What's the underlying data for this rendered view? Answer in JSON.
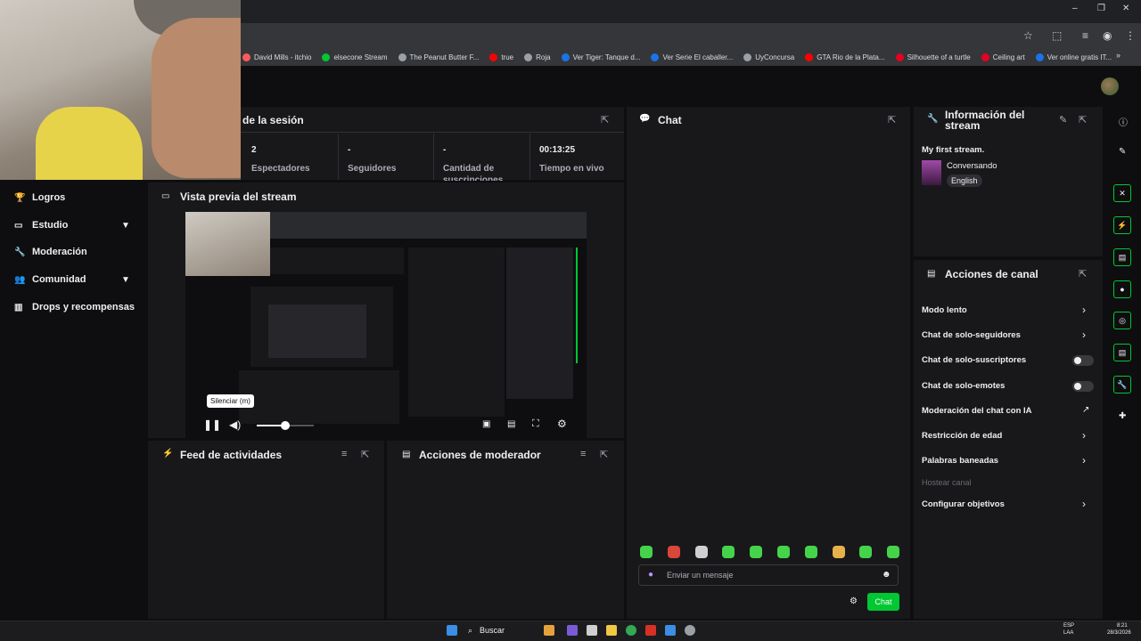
{
  "browser": {
    "bookmarks": [
      {
        "label": "David Mills - itchio",
        "color": "#fa5c5c"
      },
      {
        "label": "elsecone Stream",
        "color": "#00c832"
      },
      {
        "label": "The Peanut Butter F...",
        "color": "#9aa0a6"
      },
      {
        "label": "true",
        "color": "#ff0000"
      },
      {
        "label": "Roja",
        "color": "#9aa0a6"
      },
      {
        "label": "Ver Tiger: Tanque d...",
        "color": "#1a73e8"
      },
      {
        "label": "Ver Serie El caballer...",
        "color": "#1a73e8"
      },
      {
        "label": "UyConcursa",
        "color": "#9aa0a6"
      },
      {
        "label": "GTA Rio de la Plata...",
        "color": "#ff0000"
      },
      {
        "label": "Silhouette of a turtle",
        "color": "#e60023"
      },
      {
        "label": "Ceiling art",
        "color": "#e60023"
      },
      {
        "label": "Ver online gratis IT...",
        "color": "#1a73e8"
      }
    ],
    "window_controls": {
      "minimize": "–",
      "restore": "❐",
      "close": "✕"
    }
  },
  "session": {
    "title": "de la sesión",
    "stats": [
      {
        "value": "2",
        "label": "Espectadores"
      },
      {
        "value": "-",
        "label": "Seguidores"
      },
      {
        "value": "-",
        "label": "Cantidad de suscripciones"
      },
      {
        "value": "00:13:25",
        "label": "Tiempo en vivo"
      }
    ]
  },
  "nav": {
    "items": [
      {
        "label": "Logros",
        "icon": "trophy-icon",
        "expandable": false
      },
      {
        "label": "Estudio",
        "icon": "studio-icon",
        "expandable": true
      },
      {
        "label": "Moderación",
        "icon": "wrench-icon",
        "expandable": false
      },
      {
        "label": "Comunidad",
        "icon": "community-icon",
        "expandable": true
      },
      {
        "label": "Drops y recompensas",
        "icon": "drops-icon",
        "expandable": false
      }
    ]
  },
  "preview": {
    "title": "Vista previa del stream",
    "tooltip": "Silenciar (m)",
    "volume_level": 0.5
  },
  "activity_feed": {
    "title": "Feed de actividades"
  },
  "mod_actions": {
    "title": "Acciones de moderador"
  },
  "chat": {
    "title": "Chat",
    "placeholder": "Enviar un mensaje",
    "send_label": "Chat"
  },
  "stream_info": {
    "title": "Información del stream",
    "stream_title": "My first stream.",
    "category": "Conversando",
    "language": "English"
  },
  "channel_actions": {
    "title": "Acciones de canal",
    "items": [
      {
        "label": "Modo lento",
        "control": "chevron"
      },
      {
        "label": "Chat de solo-seguidores",
        "control": "chevron"
      },
      {
        "label": "Chat de solo-suscriptores",
        "control": "toggle",
        "on": false
      },
      {
        "label": "Chat de solo-emotes",
        "control": "toggle",
        "on": false
      },
      {
        "label": "Moderación del chat con IA",
        "control": "external"
      },
      {
        "label": "Restricción de edad",
        "control": "chevron"
      },
      {
        "label": "Palabras baneadas",
        "control": "chevron"
      },
      {
        "label": "Hostear canal",
        "control": "none",
        "disabled": true
      },
      {
        "label": "Configurar objetivos",
        "control": "chevron"
      }
    ]
  },
  "taskbar": {
    "search_label": "Buscar",
    "tray": {
      "lang": "ESP",
      "region": "LAA",
      "time": "8:21",
      "date": "28/3/2026"
    }
  },
  "colors": {
    "accent": "#00c832",
    "panel": "#18181b",
    "bg": "#0e0e10"
  }
}
